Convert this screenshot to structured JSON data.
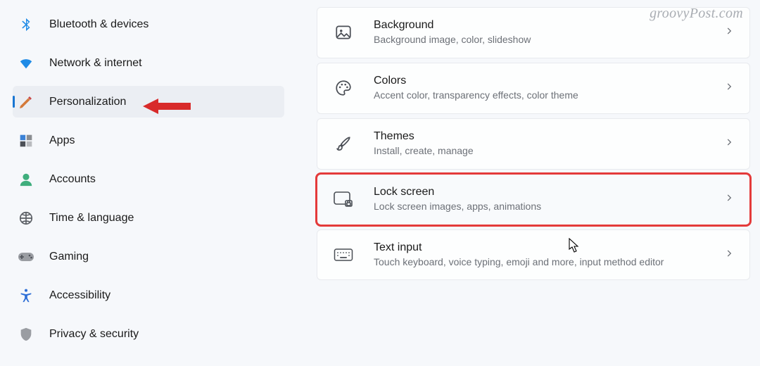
{
  "watermark": "groovyPost.com",
  "sidebar": {
    "items": [
      {
        "label": "Bluetooth & devices",
        "icon": "bluetooth",
        "active": false
      },
      {
        "label": "Network & internet",
        "icon": "wifi",
        "active": false
      },
      {
        "label": "Personalization",
        "icon": "paint",
        "active": true
      },
      {
        "label": "Apps",
        "icon": "apps",
        "active": false
      },
      {
        "label": "Accounts",
        "icon": "account",
        "active": false
      },
      {
        "label": "Time & language",
        "icon": "clock",
        "active": false
      },
      {
        "label": "Gaming",
        "icon": "gamepad",
        "active": false
      },
      {
        "label": "Accessibility",
        "icon": "accessibility",
        "active": false
      },
      {
        "label": "Privacy & security",
        "icon": "shield",
        "active": false
      }
    ]
  },
  "cards": [
    {
      "title": "Background",
      "sub": "Background image, color, slideshow",
      "icon": "image",
      "highlighted": false
    },
    {
      "title": "Colors",
      "sub": "Accent color, transparency effects, color theme",
      "icon": "palette",
      "highlighted": false
    },
    {
      "title": "Themes",
      "sub": "Install, create, manage",
      "icon": "brush",
      "highlighted": false
    },
    {
      "title": "Lock screen",
      "sub": "Lock screen images, apps, animations",
      "icon": "lockscreen",
      "highlighted": true
    },
    {
      "title": "Text input",
      "sub": "Touch keyboard, voice typing, emoji and more, input method editor",
      "icon": "keyboard",
      "highlighted": false
    }
  ]
}
